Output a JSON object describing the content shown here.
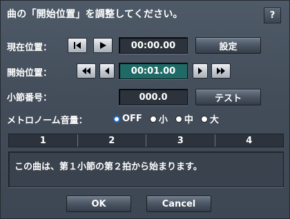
{
  "dialog": {
    "title": "曲の「開始位置」を調整してください。",
    "help_label": "?"
  },
  "current_position": {
    "label": "現在位置：",
    "value": "00:00.00",
    "set_button": "設定"
  },
  "start_position": {
    "label": "開始位置：",
    "value": "00:01.00"
  },
  "measure_number": {
    "label": "小節番号：",
    "value": "000.0",
    "test_button": "テスト"
  },
  "metronome": {
    "label": "メトロノーム音量：",
    "options": [
      "OFF",
      "小",
      "中",
      "大"
    ],
    "selected": "OFF"
  },
  "beat_tabs": [
    "1",
    "2",
    "3",
    "4"
  ],
  "message": "この曲は、第１小節の第２拍から始まります。",
  "footer": {
    "ok_label": "OK",
    "cancel_label": "Cancel"
  },
  "icons": {
    "to_start": "skip-to-start-icon",
    "play": "play-icon",
    "rewind": "rewind-icon",
    "step_back": "step-back-icon",
    "step_forward": "step-forward-icon",
    "fast_forward": "fast-forward-icon"
  },
  "colors": {
    "active_field": "#1f6a66",
    "radio_selected": "#1e6fd0"
  }
}
